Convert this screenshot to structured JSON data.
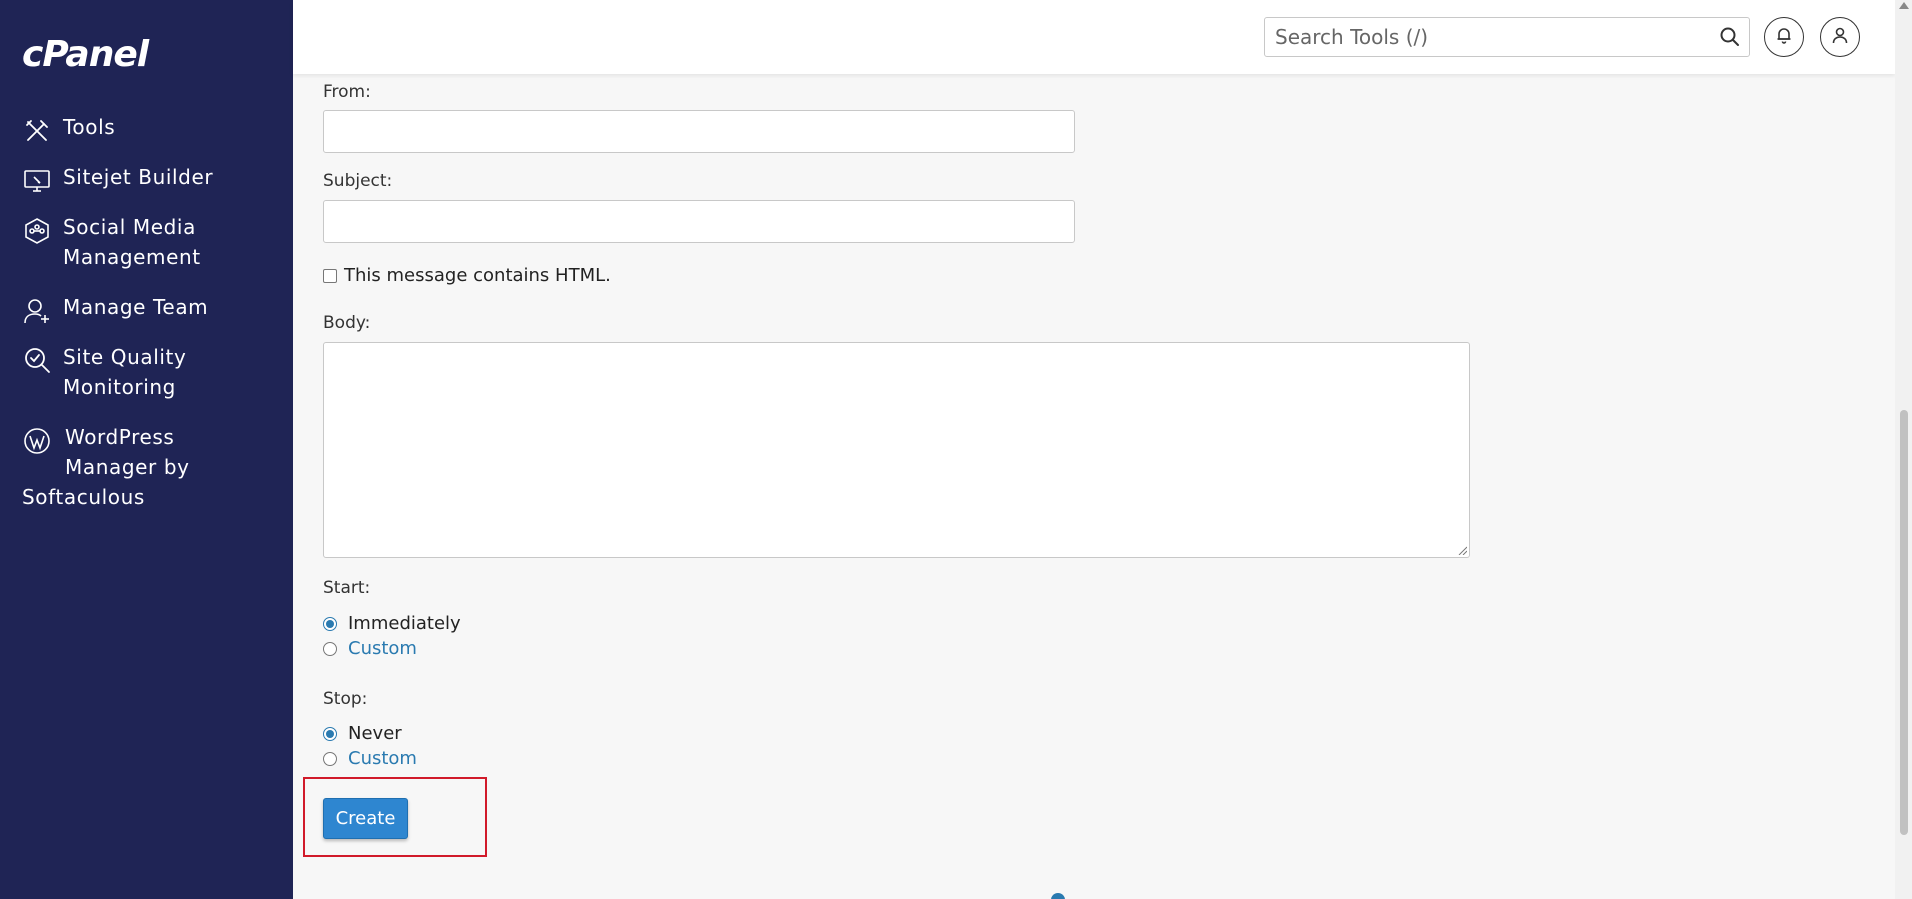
{
  "brand": {
    "logo_text": "cPanel"
  },
  "sidebar": {
    "items": [
      {
        "label": "Tools",
        "icon": "tools-icon"
      },
      {
        "label": "Sitejet Builder",
        "icon": "sitejet-icon"
      },
      {
        "label_line1": "Social Media",
        "label_line2": "Management",
        "icon": "social-media-icon"
      },
      {
        "label": "Manage Team",
        "icon": "manage-team-icon"
      },
      {
        "label_line1": "Site Quality",
        "label_line2": "Monitoring",
        "icon": "site-quality-icon"
      },
      {
        "label_line1": "WordPress",
        "label_line2": "Manager by",
        "label_line3": "Softaculous",
        "icon": "wordpress-icon"
      }
    ]
  },
  "header": {
    "search_placeholder": "Search Tools (/)",
    "notifications_icon": "bell-icon",
    "user_icon": "user-icon"
  },
  "form": {
    "from_label": "From:",
    "from_value": "",
    "subject_label": "Subject:",
    "subject_value": "",
    "html_checkbox_label": "This message contains HTML.",
    "html_checked": false,
    "body_label": "Body:",
    "body_value": "",
    "start_label": "Start:",
    "start_options": [
      {
        "label": "Immediately",
        "checked": true
      },
      {
        "label": "Custom",
        "checked": false
      }
    ],
    "stop_label": "Stop:",
    "stop_options": [
      {
        "label": "Never",
        "checked": true
      },
      {
        "label": "Custom",
        "checked": false
      }
    ],
    "create_label": "Create"
  },
  "colors": {
    "sidebar_bg": "#1f2455",
    "primary_button": "#2e86d0",
    "link": "#2a7ab0",
    "highlight_border": "#d11a2a"
  }
}
